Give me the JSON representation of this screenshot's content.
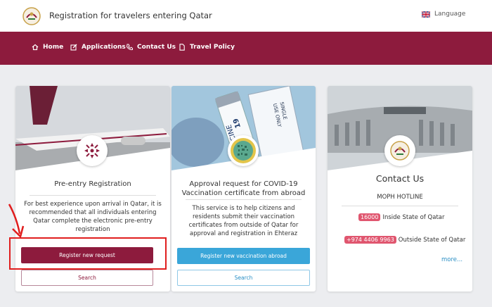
{
  "header": {
    "title": "Registration for travelers entering Qatar",
    "language_label": "Language"
  },
  "nav": {
    "items": [
      {
        "label": "Home",
        "icon": "home-icon"
      },
      {
        "label": "Applications",
        "icon": "edit-icon"
      },
      {
        "label": "Contact Us",
        "icon": "phone-icon"
      },
      {
        "label": "Travel Policy",
        "icon": "document-icon"
      }
    ]
  },
  "cards": {
    "preentry": {
      "title": "Pre-entry Registration",
      "description": "For best experience upon arrival in Qatar, it is recommended that all individuals entering Qatar complete the electronic pre-entry registration",
      "primary_button": "Register new request",
      "secondary_button": "Search"
    },
    "vaccination": {
      "title": "Approval request for COVID-19 Vaccination certificate from abroad",
      "description": "This service is to help citizens and residents submit their vaccination certificates from outside of Qatar for approval and registration in Ehteraz",
      "primary_button": "Register new vaccination abroad",
      "secondary_button": "Search",
      "image_text": {
        "vial": "VACCINE",
        "vial_num": "19",
        "box_line1": "SINGLE",
        "box_line2": "USE ONLY"
      }
    },
    "contact": {
      "title": "Contact Us",
      "hotline_label": "MOPH HOTLINE",
      "inside_number": "16000",
      "inside_label": "Inside State of Qatar",
      "outside_number": "+974 4406 9963",
      "outside_label": "Outside State of Qatar",
      "more_link": "more..."
    }
  },
  "colors": {
    "brand_maroon": "#8d1b3d",
    "accent_blue": "#3aa6d9",
    "highlight_pill": "#e0566f",
    "annotation_red": "#e01e1e"
  }
}
